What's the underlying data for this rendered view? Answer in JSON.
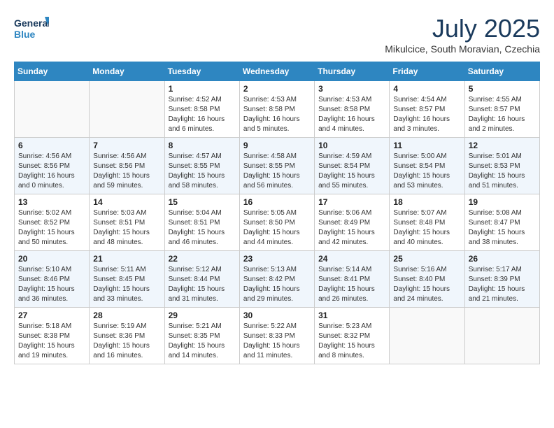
{
  "logo": {
    "line1": "General",
    "line2": "Blue"
  },
  "title": "July 2025",
  "subtitle": "Mikulcice, South Moravian, Czechia",
  "weekdays": [
    "Sunday",
    "Monday",
    "Tuesday",
    "Wednesday",
    "Thursday",
    "Friday",
    "Saturday"
  ],
  "weeks": [
    [
      {
        "day": null
      },
      {
        "day": null
      },
      {
        "day": "1",
        "sunrise": "4:52 AM",
        "sunset": "8:58 PM",
        "daylight": "16 hours and 6 minutes."
      },
      {
        "day": "2",
        "sunrise": "4:53 AM",
        "sunset": "8:58 PM",
        "daylight": "16 hours and 5 minutes."
      },
      {
        "day": "3",
        "sunrise": "4:53 AM",
        "sunset": "8:58 PM",
        "daylight": "16 hours and 4 minutes."
      },
      {
        "day": "4",
        "sunrise": "4:54 AM",
        "sunset": "8:57 PM",
        "daylight": "16 hours and 3 minutes."
      },
      {
        "day": "5",
        "sunrise": "4:55 AM",
        "sunset": "8:57 PM",
        "daylight": "16 hours and 2 minutes."
      }
    ],
    [
      {
        "day": "6",
        "sunrise": "4:56 AM",
        "sunset": "8:56 PM",
        "daylight": "16 hours and 0 minutes."
      },
      {
        "day": "7",
        "sunrise": "4:56 AM",
        "sunset": "8:56 PM",
        "daylight": "15 hours and 59 minutes."
      },
      {
        "day": "8",
        "sunrise": "4:57 AM",
        "sunset": "8:55 PM",
        "daylight": "15 hours and 58 minutes."
      },
      {
        "day": "9",
        "sunrise": "4:58 AM",
        "sunset": "8:55 PM",
        "daylight": "15 hours and 56 minutes."
      },
      {
        "day": "10",
        "sunrise": "4:59 AM",
        "sunset": "8:54 PM",
        "daylight": "15 hours and 55 minutes."
      },
      {
        "day": "11",
        "sunrise": "5:00 AM",
        "sunset": "8:54 PM",
        "daylight": "15 hours and 53 minutes."
      },
      {
        "day": "12",
        "sunrise": "5:01 AM",
        "sunset": "8:53 PM",
        "daylight": "15 hours and 51 minutes."
      }
    ],
    [
      {
        "day": "13",
        "sunrise": "5:02 AM",
        "sunset": "8:52 PM",
        "daylight": "15 hours and 50 minutes."
      },
      {
        "day": "14",
        "sunrise": "5:03 AM",
        "sunset": "8:51 PM",
        "daylight": "15 hours and 48 minutes."
      },
      {
        "day": "15",
        "sunrise": "5:04 AM",
        "sunset": "8:51 PM",
        "daylight": "15 hours and 46 minutes."
      },
      {
        "day": "16",
        "sunrise": "5:05 AM",
        "sunset": "8:50 PM",
        "daylight": "15 hours and 44 minutes."
      },
      {
        "day": "17",
        "sunrise": "5:06 AM",
        "sunset": "8:49 PM",
        "daylight": "15 hours and 42 minutes."
      },
      {
        "day": "18",
        "sunrise": "5:07 AM",
        "sunset": "8:48 PM",
        "daylight": "15 hours and 40 minutes."
      },
      {
        "day": "19",
        "sunrise": "5:08 AM",
        "sunset": "8:47 PM",
        "daylight": "15 hours and 38 minutes."
      }
    ],
    [
      {
        "day": "20",
        "sunrise": "5:10 AM",
        "sunset": "8:46 PM",
        "daylight": "15 hours and 36 minutes."
      },
      {
        "day": "21",
        "sunrise": "5:11 AM",
        "sunset": "8:45 PM",
        "daylight": "15 hours and 33 minutes."
      },
      {
        "day": "22",
        "sunrise": "5:12 AM",
        "sunset": "8:44 PM",
        "daylight": "15 hours and 31 minutes."
      },
      {
        "day": "23",
        "sunrise": "5:13 AM",
        "sunset": "8:42 PM",
        "daylight": "15 hours and 29 minutes."
      },
      {
        "day": "24",
        "sunrise": "5:14 AM",
        "sunset": "8:41 PM",
        "daylight": "15 hours and 26 minutes."
      },
      {
        "day": "25",
        "sunrise": "5:16 AM",
        "sunset": "8:40 PM",
        "daylight": "15 hours and 24 minutes."
      },
      {
        "day": "26",
        "sunrise": "5:17 AM",
        "sunset": "8:39 PM",
        "daylight": "15 hours and 21 minutes."
      }
    ],
    [
      {
        "day": "27",
        "sunrise": "5:18 AM",
        "sunset": "8:38 PM",
        "daylight": "15 hours and 19 minutes."
      },
      {
        "day": "28",
        "sunrise": "5:19 AM",
        "sunset": "8:36 PM",
        "daylight": "15 hours and 16 minutes."
      },
      {
        "day": "29",
        "sunrise": "5:21 AM",
        "sunset": "8:35 PM",
        "daylight": "15 hours and 14 minutes."
      },
      {
        "day": "30",
        "sunrise": "5:22 AM",
        "sunset": "8:33 PM",
        "daylight": "15 hours and 11 minutes."
      },
      {
        "day": "31",
        "sunrise": "5:23 AM",
        "sunset": "8:32 PM",
        "daylight": "15 hours and 8 minutes."
      },
      {
        "day": null
      },
      {
        "day": null
      }
    ]
  ]
}
